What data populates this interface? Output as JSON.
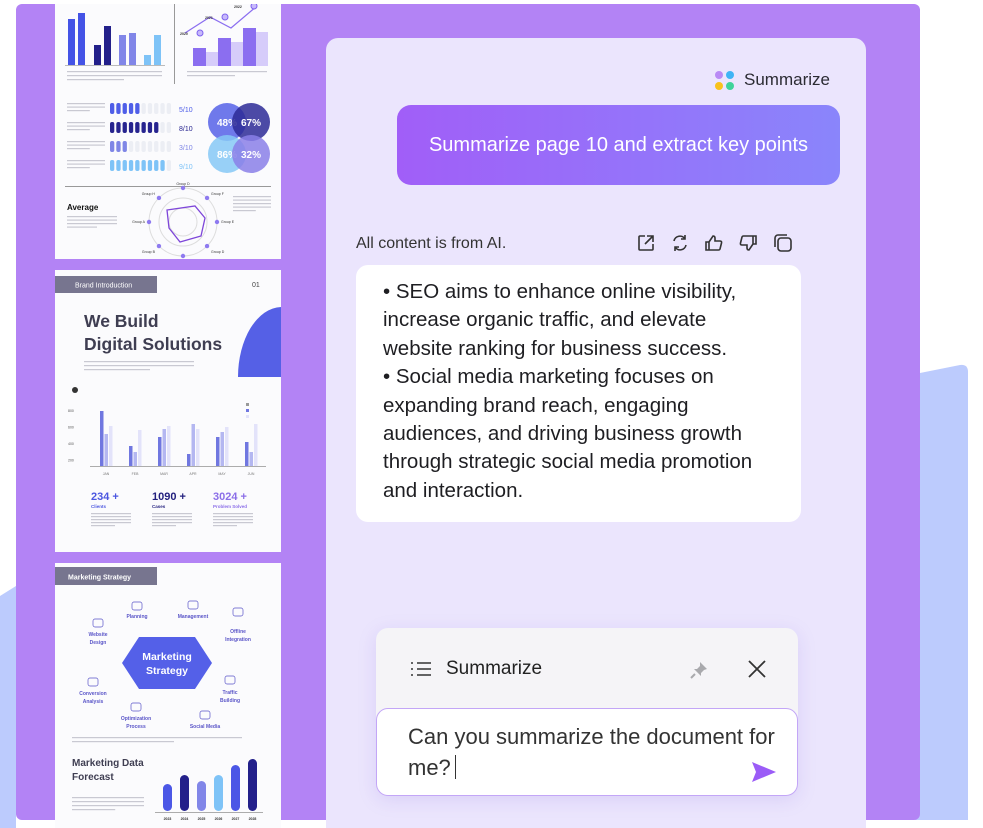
{
  "colors": {
    "frame": "#b383f5",
    "panel": "#ebe5fd",
    "accent": "#9b6cf9",
    "bg_shape": "#bccbfd"
  },
  "thumbnails": [
    {
      "line_years": [
        "2020",
        "2021",
        "2022"
      ],
      "progress": [
        {
          "label": "5/10",
          "filled": 5,
          "color": "#4f5ee8"
        },
        {
          "label": "8/10",
          "filled": 8,
          "color": "#27248f"
        },
        {
          "label": "3/10",
          "filled": 3,
          "color": "#7f86e6"
        },
        {
          "label": "9/10",
          "filled": 9,
          "color": "#7ec3f7"
        }
      ],
      "circles": [
        "48%",
        "67%",
        "86%",
        "32%"
      ],
      "average_title": "Average",
      "radar_groups": [
        "Group D",
        "Group F",
        "Group E",
        "Group D",
        "Group C",
        "Group B",
        "Group A",
        "Group H"
      ]
    },
    {
      "tag": "Brand Introduction",
      "page_no": "01",
      "title_line1": "We Build",
      "title_line2": "Digital Solutions",
      "y_ticks": [
        "800",
        "600",
        "400",
        "200"
      ],
      "months": [
        "JAN",
        "FEB",
        "MAR",
        "APR",
        "MAY",
        "JUN"
      ],
      "stats": [
        {
          "value": "234 +",
          "label": "Clients",
          "color": "#4b56e0"
        },
        {
          "value": "1090 +",
          "label": "Cases",
          "color": "#221f7e"
        },
        {
          "value": "3024 +",
          "label": "Problem Solved",
          "color": "#8b6ee8"
        }
      ]
    },
    {
      "tag": "Marketing Strategy",
      "hub_line1": "Marketing",
      "hub_line2": "Strategy",
      "nodes": [
        "Planning",
        "Management",
        "Website",
        "Design",
        "Offline",
        "Integration",
        "Conversion",
        "Analysis",
        "Traffic",
        "Building",
        "Optimization",
        "Process",
        "Social Media"
      ],
      "forecast_line1": "Marketing Data",
      "forecast_line2": "Forecast",
      "years": [
        "2023",
        "2024",
        "2025",
        "2026",
        "2027",
        "2028"
      ]
    }
  ],
  "panel": {
    "header_label": "Summarize",
    "header_icon": "four-dots-app-icon",
    "user_prompt": "Summarize page 10 and extract key points",
    "ai_note": "All content is from AI.",
    "actions": [
      "export-icon",
      "regenerate-icon",
      "thumbs-up-icon",
      "thumbs-down-icon",
      "copy-icon"
    ],
    "answer": [
      "• SEO aims to enhance online visibility, increase organic traffic, and elevate website ranking for business success.",
      "• Social media marketing focuses on expanding brand reach, engaging audiences, and driving business growth through strategic social media promotion and interaction."
    ]
  },
  "widget": {
    "title": "Summarize",
    "input_value": "Can you summarize the document for me?"
  }
}
